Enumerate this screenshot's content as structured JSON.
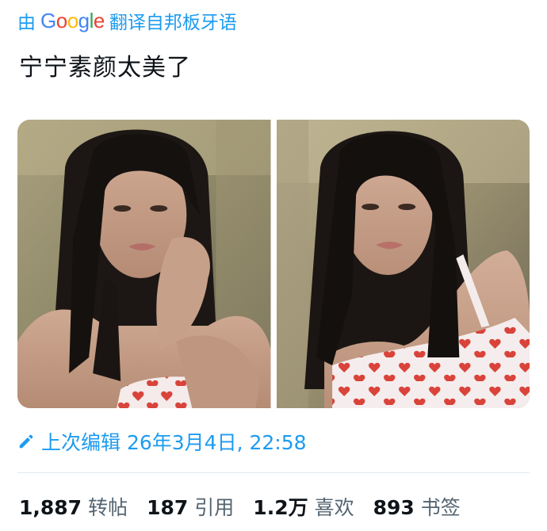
{
  "translation": {
    "prefix": "由",
    "google_logo": [
      "G",
      "o",
      "o",
      "g",
      "l",
      "e"
    ],
    "suffix": "翻译自邦板牙语"
  },
  "tweet": {
    "text": "宁宁素颜太美了"
  },
  "edited": {
    "label": "上次编辑 26年3月4日, 22:58"
  },
  "stats": [
    {
      "number": "1,887",
      "label": "转帖"
    },
    {
      "number": "187",
      "label": "引用"
    },
    {
      "number": "1.2万",
      "label": "喜欢"
    },
    {
      "number": "893",
      "label": "书签"
    }
  ],
  "colors": {
    "link_blue": "#1d9bf0",
    "text_dark": "#0f1419",
    "text_muted": "#536471",
    "divider": "#e1e8ed"
  }
}
